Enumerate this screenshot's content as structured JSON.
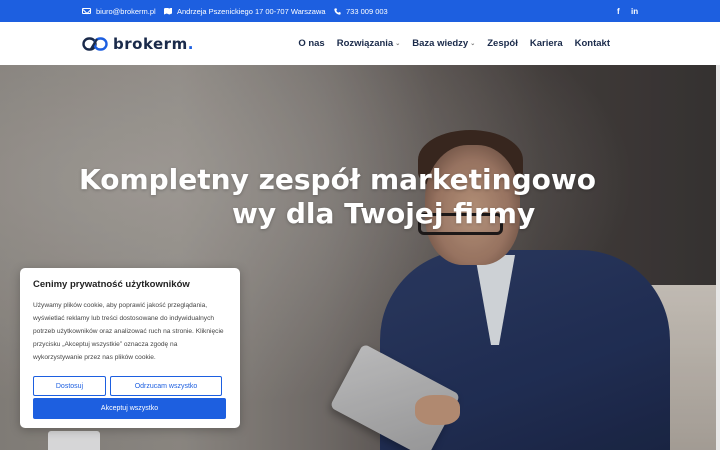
{
  "topbar": {
    "email": "biuro@brokerm.pl",
    "address": "Andrzeja Pszenickiego 17 00-707 Warszawa",
    "phone": "733 009 003",
    "social": [
      "f",
      "in"
    ]
  },
  "header": {
    "logo_text": "brokerm",
    "logo_dot": ".",
    "nav": [
      {
        "label": "O nas"
      },
      {
        "label": "Rozwiązania"
      },
      {
        "label": "Baza wiedzy"
      },
      {
        "label": "Zespół"
      },
      {
        "label": "Kariera"
      },
      {
        "label": "Kontakt"
      }
    ]
  },
  "hero": {
    "headline_line1": "Kompletny zespół marketingowo",
    "headline_line2": "wy dla Twojej firmy"
  },
  "cookie": {
    "title": "Cenimy prywatność użytkowników",
    "text": "Używamy plików cookie, aby poprawić jakość przeglądania, wyświetlać reklamy lub treści dostosowane do indywidualnych potrzeb użytkowników oraz analizować ruch na stronie. Kliknięcie przycisku „Akceptuj wszystkie” oznacza zgodę na wykorzystywanie przez nas plików cookie.",
    "customize": "Dostosuj",
    "reject": "Odrzucam wszystko",
    "accept": "Akceptuj wszystko"
  },
  "colors": {
    "brand": "#1d5fe0",
    "navy": "#1a2a4a"
  }
}
